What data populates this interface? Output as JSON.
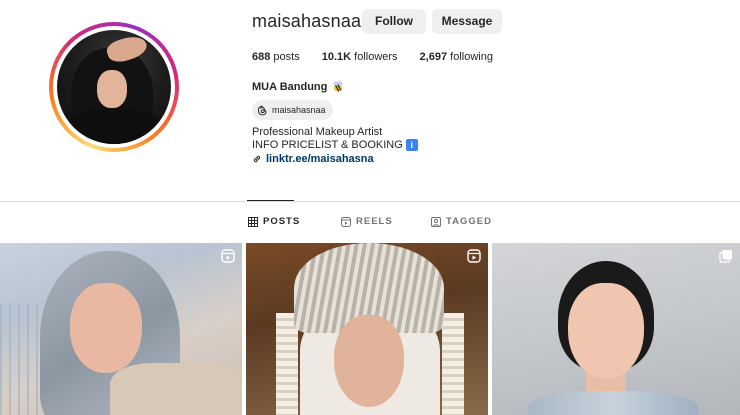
{
  "profile": {
    "username": "maisahasnaa",
    "follow_label": "Follow",
    "message_label": "Message",
    "stats": {
      "posts_count": "688",
      "posts_label": "posts",
      "followers_count": "10.1K",
      "followers_label": "followers",
      "following_count": "2,697",
      "following_label": "following"
    },
    "full_name": "MUA Bandung",
    "threads_handle": "maisahasnaa",
    "bio_line1": "Professional Makeup Artist",
    "bio_line2": "INFO PRICELIST & BOOKING",
    "info_emoji": "i",
    "link": "linktr.ee/maisahasna"
  },
  "tabs": [
    {
      "label": "POSTS",
      "icon": "grid-icon",
      "active": true
    },
    {
      "label": "REELS",
      "icon": "reels-icon",
      "active": false
    },
    {
      "label": "TAGGED",
      "icon": "tagged-icon",
      "active": false
    }
  ],
  "posts": [
    {
      "type": "reel",
      "icon": "reels-icon"
    },
    {
      "type": "reel",
      "icon": "reels-icon"
    },
    {
      "type": "carousel",
      "icon": "carousel-icon"
    }
  ],
  "colors": {
    "ring_gradient": [
      "#feda75",
      "#fa7e1e",
      "#d62976",
      "#962fbf"
    ],
    "link": "#00376b",
    "button_bg": "#efefef"
  }
}
